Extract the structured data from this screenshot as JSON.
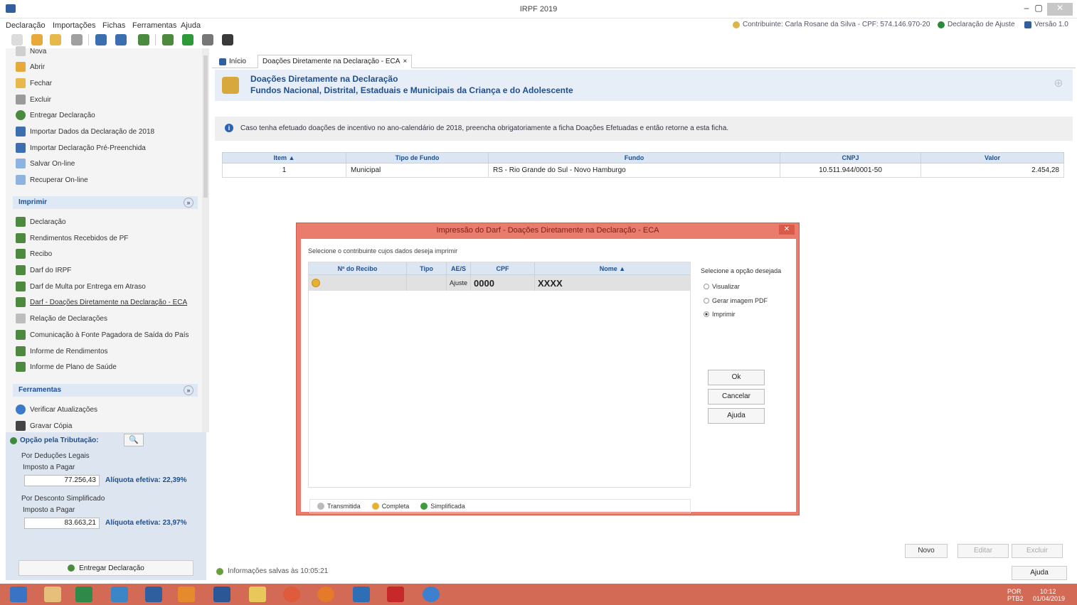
{
  "window": {
    "title": "IRPF 2019",
    "min": "–",
    "max": "▢",
    "close": "✕"
  },
  "menu": {
    "items": [
      "Declaração",
      "Importações",
      "Fichas",
      "Ferramentas",
      "Ajuda"
    ],
    "contributor": "Contribuinte: Carla Rosane da Silva - CPF: 574.146.970-20",
    "help_decl": "Declaração de Ajuste",
    "version": "Versão 1.0"
  },
  "sidebar": {
    "items": [
      {
        "label": "Nova",
        "icon": "new-file-icon",
        "color": "#cfcfcf"
      },
      {
        "label": "Abrir",
        "icon": "open-icon",
        "color": "#e6a93a"
      },
      {
        "label": "Fechar",
        "icon": "folder-icon",
        "color": "#e6b94a"
      },
      {
        "label": "Excluir",
        "icon": "trash-icon",
        "color": "#9a9a9a"
      },
      {
        "label": "Entregar Declaração",
        "icon": "globe-icon",
        "color": "#4a8b3f"
      },
      {
        "label": "Importar Dados da Declaração de 2018",
        "icon": "import-icon",
        "color": "#3b6fb0"
      },
      {
        "label": "Importar Declaração Pré-Preenchida",
        "icon": "import-prefill-icon",
        "color": "#3b6fb0"
      },
      {
        "label": "Salvar On-line",
        "icon": "cloud-save-icon",
        "color": "#8db4e0"
      },
      {
        "label": "Recuperar On-line",
        "icon": "cloud-restore-icon",
        "color": "#8db4e0"
      }
    ],
    "print_section": "Imprimir",
    "print_items": [
      {
        "label": "Declaração",
        "underline": false,
        "icon": "printer-icon",
        "color": "#4d8a3f"
      },
      {
        "label": "Rendimentos Recebidos de PF",
        "underline": false,
        "icon": "printer-icon",
        "color": "#4d8a3f"
      },
      {
        "label": "Recibo",
        "underline": false,
        "icon": "printer-icon",
        "color": "#4d8a3f"
      },
      {
        "label": "Darf do IRPF",
        "underline": false,
        "icon": "printer-icon",
        "color": "#4d8a3f"
      },
      {
        "label": "Darf de Multa por Entrega em Atraso",
        "underline": false,
        "icon": "printer-icon",
        "color": "#4d8a3f"
      },
      {
        "label": "Darf - Doações Diretamente na Declaração - ECA",
        "underline": true,
        "icon": "printer-icon",
        "color": "#4d8a3f"
      },
      {
        "label": "Relação de Declarações",
        "underline": false,
        "icon": "list-icon",
        "color": "#bdbdbd"
      },
      {
        "label": "Comunicação à Fonte Pagadora de Saída do País",
        "underline": false,
        "icon": "printer-icon",
        "color": "#4d8a3f"
      },
      {
        "label": "Informe de Rendimentos",
        "underline": false,
        "icon": "printer-icon",
        "color": "#4d8a3f"
      },
      {
        "label": "Informe de Plano de Saúde",
        "underline": false,
        "icon": "printer-icon",
        "color": "#4d8a3f"
      }
    ],
    "tools_section": "Ferramentas",
    "tools_items": [
      {
        "label": "Verificar Atualizações",
        "icon": "refresh-icon",
        "color": "#3a7ac8"
      },
      {
        "label": "Gravar Cópia",
        "icon": "save-icon",
        "color": "#444"
      }
    ],
    "collapse": "»"
  },
  "tax_option": {
    "title": "Opção pela Tributação:",
    "search_glyph": "🔍",
    "legal": {
      "label": "Por Deduções Legais",
      "tax_label": "Imposto a Pagar",
      "value": "77.256,43",
      "aliquot": "Alíquota efetiva: 22,39%"
    },
    "simplified": {
      "label": "Por Desconto Simplificado",
      "tax_label": "Imposto a Pagar",
      "value": "83.663,21",
      "aliquot": "Alíquota efetiva: 23,97%"
    },
    "deliver_label": "Entregar Declaração"
  },
  "tabs": {
    "home": "Início",
    "active": "Doações Diretamente na Declaração - ECA",
    "close": "×"
  },
  "banner": {
    "title": "Doações Diretamente na Declaração",
    "subtitle": "Fundos Nacional, Distrital, Estaduais e Municipais da Criança e do Adolescente",
    "pin": "⊕"
  },
  "info": {
    "icon_glyph": "i",
    "text": "Caso tenha efetuado doações de incentivo no ano-calendário de 2018, preencha obrigatoriamente a ficha Doações Efetuadas e então retorne a esta ficha."
  },
  "table": {
    "headers": [
      "Item ▲",
      "Tipo de Fundo",
      "Fundo",
      "CNPJ",
      "Valor"
    ],
    "rows": [
      {
        "item": "1",
        "tipo": "Municipal",
        "fundo": "RS - Rio Grande do Sul - Novo Hamburgo",
        "cnpj": "10.511.944/0001-50",
        "valor": "2.454,28"
      }
    ]
  },
  "dialog": {
    "title": "Impressão do Darf - Doações Diretamente na Declaração - ECA",
    "close": "✕",
    "prompt": "Selecione o contribuinte cujos dados deseja imprimir",
    "headers": [
      "Nº do Recibo",
      "Tipo",
      "AE/S",
      "CPF",
      "Nome ▲"
    ],
    "row": {
      "recibo": "",
      "tipo": "",
      "aes": "Ajuste",
      "cpf": "0000",
      "nome": "XXXX"
    },
    "legend": [
      "Transmitida",
      "Completa",
      "Simplificada"
    ],
    "options_label": "Selecione a opção desejada",
    "options": [
      "Visualizar",
      "Gerar imagem PDF",
      "Imprimir"
    ],
    "selected_option": "Imprimir",
    "buttons": [
      "Ok",
      "Cancelar",
      "Ajuda"
    ]
  },
  "footer": {
    "buttons": [
      "Novo",
      "Editar",
      "Excluir"
    ],
    "help": "Ajuda",
    "status": "Informações salvas às 10:05:21"
  },
  "taskbar": {
    "lang": "POR\nPTB2",
    "time": "10:12",
    "date": "01/04/2019"
  },
  "colors": {
    "accent": "#1d4f91",
    "dialog": "#e97c6d",
    "taskbar": "#d36a55"
  }
}
